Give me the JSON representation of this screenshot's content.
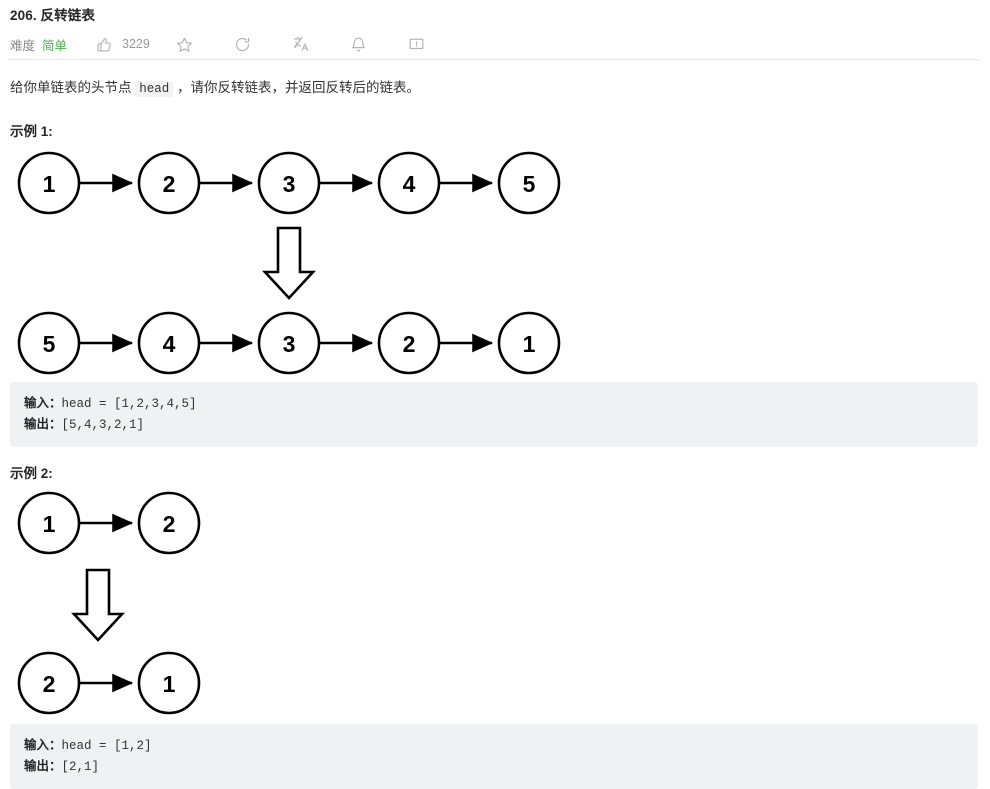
{
  "header": {
    "title": "206. 反转链表",
    "difficulty_label": "难度",
    "difficulty_value": "简单",
    "like_count": "3229",
    "icons": {
      "like": "thumbs-up-icon",
      "favorite": "star-icon",
      "share": "share-icon",
      "translate": "translate-icon",
      "notification": "bell-icon",
      "feedback": "feedback-icon"
    }
  },
  "description": {
    "before_code": "给你单链表的头节点 ",
    "code": "head",
    "after_code": " ，请你反转链表，并返回反转后的链表。"
  },
  "examples": [
    {
      "heading": "示例 1:",
      "input_label": "输入：",
      "input_value": "head = [1,2,3,4,5]",
      "output_label": "输出：",
      "output_value": "[5,4,3,2,1]",
      "diagram": {
        "top_nodes": [
          "1",
          "2",
          "3",
          "4",
          "5"
        ],
        "bottom_nodes": [
          "5",
          "4",
          "3",
          "2",
          "1"
        ],
        "transform_arrow": "down-arrow-icon"
      }
    },
    {
      "heading": "示例 2:",
      "input_label": "输入：",
      "input_value": "head = [1,2]",
      "output_label": "输出：",
      "output_value": "[2,1]",
      "diagram": {
        "top_nodes": [
          "1",
          "2"
        ],
        "bottom_nodes": [
          "2",
          "1"
        ],
        "transform_arrow": "down-arrow-icon"
      }
    }
  ],
  "colors": {
    "difficulty_easy": "#4caf50",
    "code_background": "#f0f1f3",
    "divider": "#e6e6e6",
    "node_stroke": "#000000"
  }
}
